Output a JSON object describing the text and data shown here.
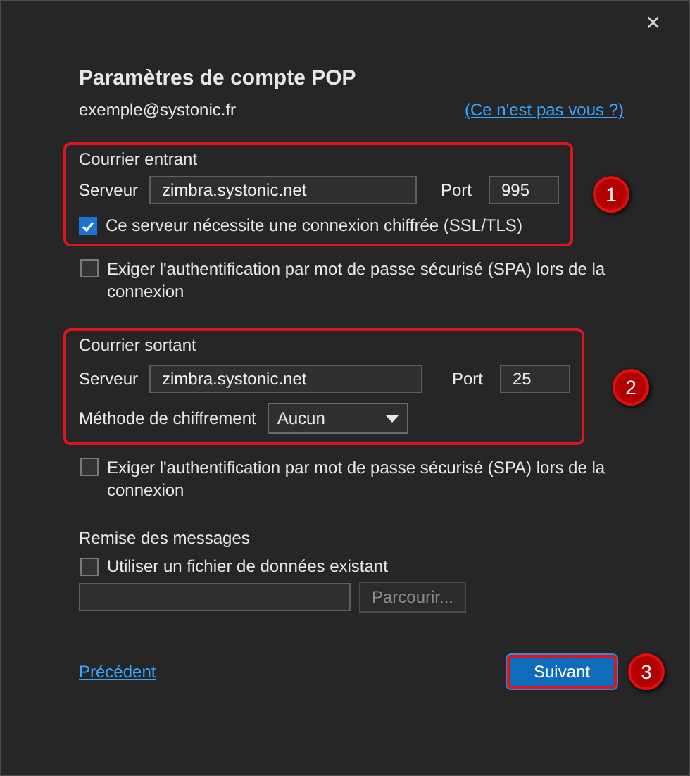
{
  "window": {
    "close": "✕"
  },
  "title": "Paramètres de compte POP",
  "email": "exemple@systonic.fr",
  "not_you_link": "(Ce n'est pas vous ?)",
  "incoming": {
    "heading": "Courrier entrant",
    "server_label": "Serveur",
    "server": "zimbra.systonic.net",
    "port_label": "Port",
    "port": "995",
    "ssl": {
      "label": "Ce serveur nécessite une connexion chiffrée (SSL/TLS)",
      "checked": true
    },
    "badge": "1"
  },
  "incoming_spa": {
    "label": "Exiger l'authentification par mot de passe sécurisé (SPA) lors de la connexion",
    "checked": false
  },
  "outgoing": {
    "heading": "Courrier sortant",
    "server_label": "Serveur",
    "server": "zimbra.systonic.net",
    "port_label": "Port",
    "port": "25",
    "encryption_label": "Méthode de chiffrement",
    "encryption": "Aucun",
    "badge": "2"
  },
  "outgoing_spa": {
    "label": "Exiger l'authentification par mot de passe sécurisé (SPA) lors de la connexion",
    "checked": false
  },
  "delivery": {
    "heading": "Remise des messages",
    "existing_file": {
      "label": "Utiliser un fichier de données existant",
      "checked": false
    },
    "browse_button": "Parcourir...",
    "browse_disabled": true
  },
  "footer": {
    "back_link": "Précédent",
    "next_button": "Suivant",
    "badge": "3"
  }
}
